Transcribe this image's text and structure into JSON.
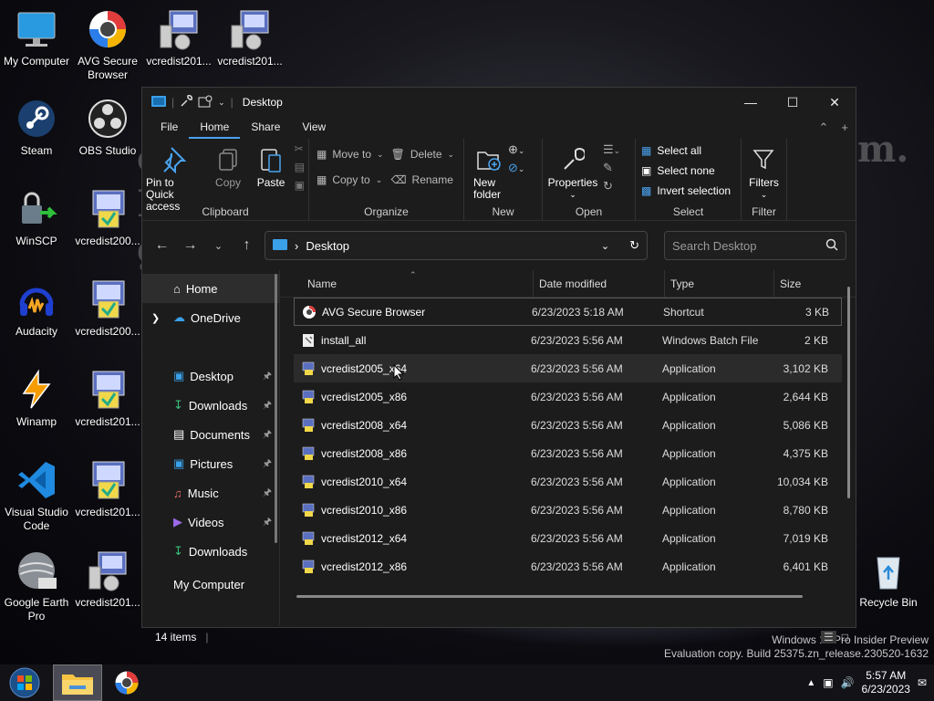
{
  "desktop": {
    "icons": [
      {
        "label": "My Computer"
      },
      {
        "label": "AVG Secure Browser"
      },
      {
        "label": "vcredist201..."
      },
      {
        "label": "vcredist201..."
      },
      {
        "label": "Steam"
      },
      {
        "label": "OBS Studio"
      },
      {
        "label": "WinSCP"
      },
      {
        "label": "vcredist200..."
      },
      {
        "label": "Audacity"
      },
      {
        "label": "vcredist200..."
      },
      {
        "label": "Winamp"
      },
      {
        "label": "vcredist201..."
      },
      {
        "label": "Visual Studio Code"
      },
      {
        "label": "vcredist201..."
      },
      {
        "label": "Google Earth Pro"
      },
      {
        "label": "vcredist201..."
      },
      {
        "label": "Recycle Bin"
      }
    ],
    "watermark": {
      "line1": "Windows 11 Pro Insider Preview",
      "line2": "Evaluation copy. Build 25375.zn_release.230520-1632"
    }
  },
  "window": {
    "title": "Desktop",
    "tabs": [
      "File",
      "Home",
      "Share",
      "View"
    ],
    "ribbon": {
      "clipboard": {
        "title": "Clipboard",
        "pin": "Pin to Quick access",
        "copy": "Copy",
        "paste": "Paste"
      },
      "organize": {
        "title": "Organize",
        "move_to": "Move to",
        "copy_to": "Copy to",
        "delete": "Delete",
        "rename": "Rename"
      },
      "new": {
        "title": "New",
        "new_folder": "New folder"
      },
      "open": {
        "title": "Open",
        "properties": "Properties"
      },
      "select": {
        "title": "Select",
        "select_all": "Select all",
        "select_none": "Select none",
        "invert": "Invert selection"
      },
      "filter": {
        "title": "Filter",
        "filters": "Filters"
      }
    },
    "address": {
      "path": "Desktop",
      "search_placeholder": "Search Desktop"
    },
    "nav": [
      {
        "label": "Home"
      },
      {
        "label": "OneDrive"
      },
      {
        "label": "Desktop"
      },
      {
        "label": "Downloads"
      },
      {
        "label": "Documents"
      },
      {
        "label": "Pictures"
      },
      {
        "label": "Music"
      },
      {
        "label": "Videos"
      },
      {
        "label": "Downloads"
      },
      {
        "label": "My Computer"
      }
    ],
    "columns": [
      "Name",
      "Date modified",
      "Type",
      "Size"
    ],
    "files": [
      {
        "name": "AVG Secure Browser",
        "date": "6/23/2023 5:18 AM",
        "type": "Shortcut",
        "size": "3 KB"
      },
      {
        "name": "install_all",
        "date": "6/23/2023 5:56 AM",
        "type": "Windows Batch File",
        "size": "2 KB"
      },
      {
        "name": "vcredist2005_x64",
        "date": "6/23/2023 5:56 AM",
        "type": "Application",
        "size": "3,102 KB"
      },
      {
        "name": "vcredist2005_x86",
        "date": "6/23/2023 5:56 AM",
        "type": "Application",
        "size": "2,644 KB"
      },
      {
        "name": "vcredist2008_x64",
        "date": "6/23/2023 5:56 AM",
        "type": "Application",
        "size": "5,086 KB"
      },
      {
        "name": "vcredist2008_x86",
        "date": "6/23/2023 5:56 AM",
        "type": "Application",
        "size": "4,375 KB"
      },
      {
        "name": "vcredist2010_x64",
        "date": "6/23/2023 5:56 AM",
        "type": "Application",
        "size": "10,034 KB"
      },
      {
        "name": "vcredist2010_x86",
        "date": "6/23/2023 5:56 AM",
        "type": "Application",
        "size": "8,780 KB"
      },
      {
        "name": "vcredist2012_x64",
        "date": "6/23/2023 5:56 AM",
        "type": "Application",
        "size": "7,019 KB"
      },
      {
        "name": "vcredist2012_x86",
        "date": "6/23/2023 5:56 AM",
        "type": "Application",
        "size": "6,401 KB"
      }
    ],
    "status": {
      "items": "14 items"
    }
  },
  "taskbar": {
    "time": "5:57 AM",
    "date": "6/23/2023"
  }
}
